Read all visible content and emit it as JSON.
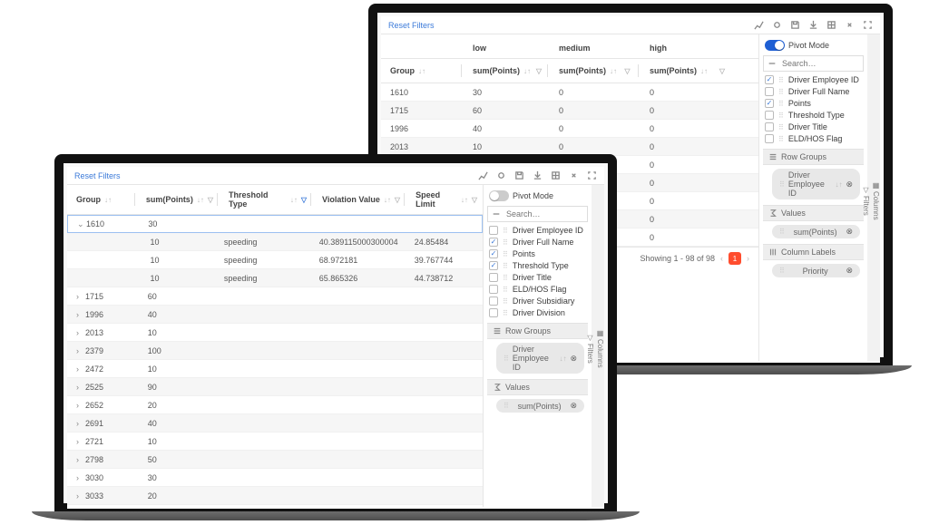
{
  "common": {
    "reset_filters": "Reset Filters",
    "pivot_mode": "Pivot Mode",
    "search_placeholder": "Search…",
    "row_groups_label": "Row Groups",
    "values_label": "Values",
    "column_labels_label": "Column Labels",
    "side_tab_columns": "Columns",
    "side_tab_filters": "Filters"
  },
  "back": {
    "headers": {
      "group": "Group",
      "low": "low",
      "medium": "medium",
      "high": "high",
      "agg": "sum(Points)"
    },
    "rows": [
      {
        "group": "1610",
        "low": "30",
        "medium": "0",
        "high": "0"
      },
      {
        "group": "1715",
        "low": "60",
        "medium": "0",
        "high": "0"
      },
      {
        "group": "1996",
        "low": "40",
        "medium": "0",
        "high": "0"
      },
      {
        "group": "2013",
        "low": "10",
        "medium": "0",
        "high": "0"
      },
      {
        "group": "",
        "low": "",
        "medium": "0",
        "high": "0"
      },
      {
        "group": "",
        "low": "",
        "medium": "0",
        "high": "0"
      },
      {
        "group": "",
        "low": "",
        "medium": "0",
        "high": "0"
      },
      {
        "group": "",
        "low": "",
        "medium": "0",
        "high": "0"
      },
      {
        "group": "",
        "low": "",
        "medium": "",
        "high": "0"
      }
    ],
    "panel_items": [
      {
        "label": "Driver Employee ID",
        "checked": true
      },
      {
        "label": "Driver Full Name",
        "checked": false
      },
      {
        "label": "Points",
        "checked": true
      },
      {
        "label": "Threshold Type",
        "checked": false
      },
      {
        "label": "Driver Title",
        "checked": false
      },
      {
        "label": "ELD/HOS Flag",
        "checked": false
      }
    ],
    "row_group_chip": "Driver Employee ID",
    "values_chip": "sum(Points)",
    "column_chip": "Priority",
    "pager_text": "Showing 1 - 98 of 98",
    "pager_current": "1"
  },
  "front": {
    "headers": {
      "group": "Group",
      "sum_points": "sum(Points)",
      "threshold_type": "Threshold Type",
      "violation_value": "Violation Value",
      "speed_limit": "Speed Limit"
    },
    "rows": [
      {
        "chev": "v",
        "group": "1610",
        "sum": "30",
        "ttype": "",
        "vval": "",
        "speed": ""
      },
      {
        "chev": "",
        "group": "",
        "sum": "10",
        "ttype": "speeding",
        "vval": "40.389115000300004",
        "speed": "24.85484"
      },
      {
        "chev": "",
        "group": "",
        "sum": "10",
        "ttype": "speeding",
        "vval": "68.972181",
        "speed": "39.767744"
      },
      {
        "chev": "",
        "group": "",
        "sum": "10",
        "ttype": "speeding",
        "vval": "65.865326",
        "speed": "44.738712"
      },
      {
        "chev": ">",
        "group": "1715",
        "sum": "60",
        "ttype": "",
        "vval": "",
        "speed": ""
      },
      {
        "chev": ">",
        "group": "1996",
        "sum": "40",
        "ttype": "",
        "vval": "",
        "speed": ""
      },
      {
        "chev": ">",
        "group": "2013",
        "sum": "10",
        "ttype": "",
        "vval": "",
        "speed": ""
      },
      {
        "chev": ">",
        "group": "2379",
        "sum": "100",
        "ttype": "",
        "vval": "",
        "speed": ""
      },
      {
        "chev": ">",
        "group": "2472",
        "sum": "10",
        "ttype": "",
        "vval": "",
        "speed": ""
      },
      {
        "chev": ">",
        "group": "2525",
        "sum": "90",
        "ttype": "",
        "vval": "",
        "speed": ""
      },
      {
        "chev": ">",
        "group": "2652",
        "sum": "20",
        "ttype": "",
        "vval": "",
        "speed": ""
      },
      {
        "chev": ">",
        "group": "2691",
        "sum": "40",
        "ttype": "",
        "vval": "",
        "speed": ""
      },
      {
        "chev": ">",
        "group": "2721",
        "sum": "10",
        "ttype": "",
        "vval": "",
        "speed": ""
      },
      {
        "chev": ">",
        "group": "2798",
        "sum": "50",
        "ttype": "",
        "vval": "",
        "speed": ""
      },
      {
        "chev": ">",
        "group": "3030",
        "sum": "30",
        "ttype": "",
        "vval": "",
        "speed": ""
      },
      {
        "chev": ">",
        "group": "3033",
        "sum": "20",
        "ttype": "",
        "vval": "",
        "speed": ""
      }
    ],
    "panel_items": [
      {
        "label": "Driver Employee ID",
        "checked": false
      },
      {
        "label": "Driver Full Name",
        "checked": true
      },
      {
        "label": "Points",
        "checked": true
      },
      {
        "label": "Threshold Type",
        "checked": true
      },
      {
        "label": "Driver Title",
        "checked": false
      },
      {
        "label": "ELD/HOS Flag",
        "checked": false
      },
      {
        "label": "Driver Subsidiary",
        "checked": false
      },
      {
        "label": "Driver Division",
        "checked": false
      }
    ],
    "row_group_chip": "Driver Employee ID",
    "values_chip": "sum(Points)"
  }
}
